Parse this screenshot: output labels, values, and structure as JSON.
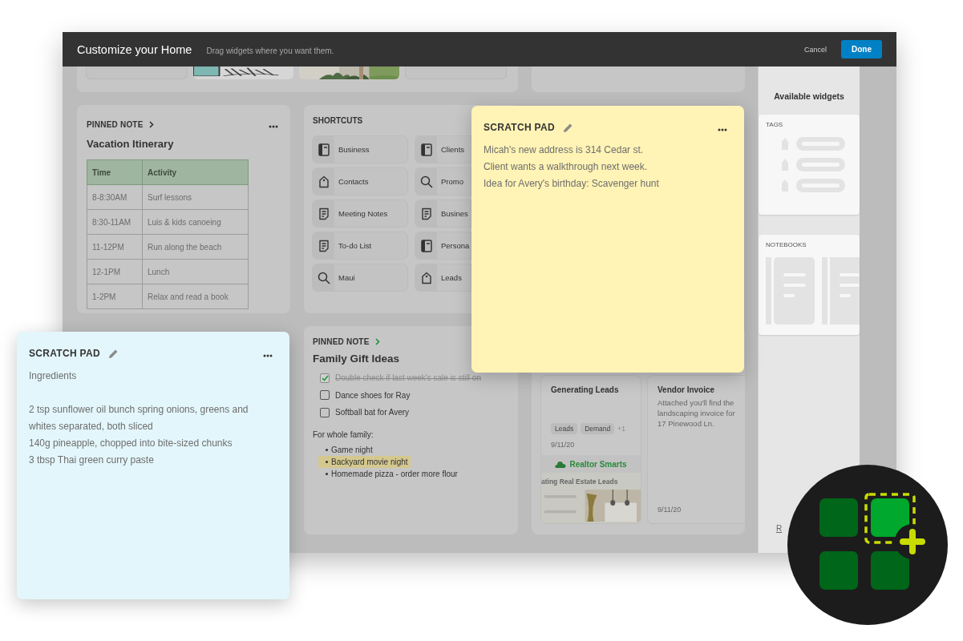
{
  "header": {
    "title": "Customize your Home",
    "subtitle": "Drag widgets where you want them.",
    "buttons": [
      {
        "label": "Cancel",
        "kind": "text"
      },
      {
        "label": "Done",
        "kind": "primary"
      }
    ]
  },
  "pinned_itinerary": {
    "label": "PINNED NOTE",
    "title": "Vacation Itinerary",
    "table": {
      "columns": [
        "Time",
        "Activity"
      ],
      "rows": [
        [
          "8-8:30AM",
          "Surf lessons"
        ],
        [
          "8:30-11AM",
          "Luis & kids canoeing"
        ],
        [
          "11-12PM",
          "Run along the beach"
        ],
        [
          "12-1PM",
          "Lunch"
        ],
        [
          "1-2PM",
          "Relax and read a book"
        ]
      ]
    }
  },
  "shortcuts": {
    "title": "SHORTCUTS",
    "items": [
      {
        "label": "Business",
        "kind": "notebook"
      },
      {
        "label": "Clients",
        "kind": "notebook"
      },
      {
        "label": "Contacts",
        "kind": "tag"
      },
      {
        "label": "Promo",
        "kind": "search"
      },
      {
        "label": "Meeting Notes",
        "kind": "note"
      },
      {
        "label": "Busines",
        "kind": "note"
      },
      {
        "label": "To-do List",
        "kind": "note"
      },
      {
        "label": "Persona",
        "kind": "notebook"
      },
      {
        "label": "Maui",
        "kind": "search"
      },
      {
        "label": "Leads",
        "kind": "tag"
      }
    ]
  },
  "pinned_gifts": {
    "label": "PINNED NOTE",
    "title": "Family Gift Ideas",
    "todos": [
      {
        "text": "Double check if last week's sale is still on",
        "checked": true
      },
      {
        "text": "Dance shoes for Ray",
        "checked": false
      },
      {
        "text": "Softball bat for Avery",
        "checked": false
      }
    ],
    "subheading": "For whole family:",
    "bullets": [
      {
        "text": "Game night",
        "highlighted": false
      },
      {
        "text": "Backyard movie night",
        "highlighted": true
      },
      {
        "text": "Homemade pizza - order more flour",
        "highlighted": false
      }
    ]
  },
  "notes": [
    {
      "title": "Generating Leads",
      "tags": [
        "Leads",
        "Demand"
      ],
      "more_tags": "+1",
      "date": "9/11/20",
      "preview": {
        "brand": "Realtor Smarts",
        "headline": "ating Real Estate Leads"
      }
    },
    {
      "title": "Vendor Invoice",
      "body": "Attached you'll find the landscaping invoice for 17 Pinewood Ln.",
      "date": "9/11/20"
    }
  ],
  "scratch_pads": [
    {
      "title": "SCRATCH PAD",
      "color": "#fff3b5",
      "paragraphs": [
        [
          "Micah's new address is 314 Cedar st.",
          "Client wants a walkthrough next week.",
          "Idea for Avery's birthday: Scavenger hunt"
        ]
      ]
    },
    {
      "title": "SCRATCH PAD",
      "color": "#e3f6fb",
      "paragraphs": [
        [
          "Ingredients"
        ],
        [
          "2 tsp sunflower oil bunch spring onions, greens and whites separated, both sliced",
          "140g pineapple, chopped into bite-sized chunks",
          "3 tbsp Thai green curry paste"
        ]
      ]
    }
  ],
  "sidebar": {
    "title": "Available widgets",
    "widgets": [
      {
        "label": "TAGS",
        "kind": "tags"
      },
      {
        "label": "NOTEBOOKS",
        "kind": "notebooks"
      }
    ],
    "link": "R"
  }
}
